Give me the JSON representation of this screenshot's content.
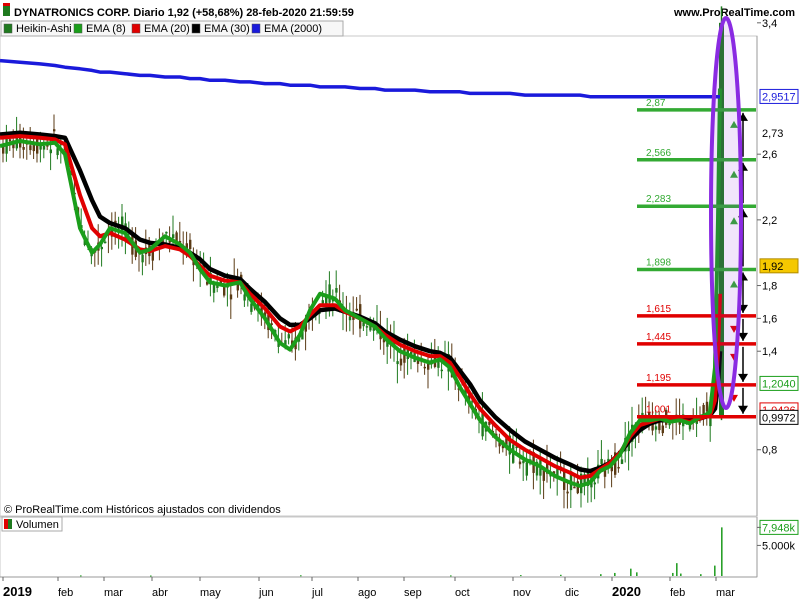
{
  "header": {
    "title": "DYNATRONICS CORP. Diario 1,92 (+58,68%) 28-feb-2020 21:59:59",
    "site": "www.ProRealTime.com"
  },
  "legend": [
    {
      "label": "Heikin-Ashi",
      "color": "#1f7a1f"
    },
    {
      "label": "EMA (8)",
      "color": "#1a9e1a"
    },
    {
      "label": "EMA (20)",
      "color": "#e00000"
    },
    {
      "label": "EMA (30)",
      "color": "#000000"
    },
    {
      "label": "EMA (2000)",
      "color": "#1a1adb"
    }
  ],
  "footer_note": "© ProRealTime.com Históricos ajustados con dividendos",
  "volume_label": "Volumen",
  "chart_data": {
    "type": "line",
    "price_axis": {
      "ylim": [
        0.5,
        3.5
      ],
      "ticks": [
        {
          "v": 3.4,
          "label": "3,4"
        },
        {
          "v": 2.6,
          "label": "2,6"
        },
        {
          "v": 2.2,
          "label": "2,2"
        },
        {
          "v": 1.8,
          "label": "1,8"
        },
        {
          "v": 1.6,
          "label": "1,6"
        },
        {
          "v": 1.4,
          "label": "1,4"
        },
        {
          "v": 0.8,
          "label": "0,8"
        }
      ]
    },
    "time_axis": [
      {
        "label": "2019",
        "bold": true
      },
      {
        "label": "feb"
      },
      {
        "label": "mar"
      },
      {
        "label": "abr"
      },
      {
        "label": "may"
      },
      {
        "label": "jun"
      },
      {
        "label": "jul"
      },
      {
        "label": "ago"
      },
      {
        "label": "sep"
      },
      {
        "label": "oct"
      },
      {
        "label": "nov"
      },
      {
        "label": "dic"
      },
      {
        "label": "2020",
        "bold": true
      },
      {
        "label": "feb"
      },
      {
        "label": "mar"
      }
    ],
    "ema_x": [
      0,
      20,
      40,
      55,
      65,
      80,
      92,
      100,
      110,
      125,
      140,
      150,
      165,
      180,
      190,
      200,
      210,
      225,
      240,
      250,
      265,
      280,
      290,
      300,
      310,
      320,
      335,
      345,
      360,
      375,
      385,
      400,
      415,
      430,
      440,
      450,
      460,
      470,
      480,
      495,
      510,
      525,
      540,
      555,
      570,
      580,
      590,
      600,
      610,
      620,
      630,
      640,
      650,
      660,
      670,
      680,
      690,
      700,
      705,
      710,
      715,
      718,
      720
    ],
    "series": [
      {
        "name": "EMA (8)",
        "color": "#1a9e1a",
        "values": [
          2.65,
          2.68,
          2.66,
          2.67,
          2.6,
          2.15,
          2.0,
          2.05,
          2.15,
          2.12,
          2.0,
          2.02,
          2.1,
          2.05,
          2.0,
          1.9,
          1.82,
          1.8,
          1.82,
          1.72,
          1.6,
          1.45,
          1.41,
          1.5,
          1.65,
          1.75,
          1.72,
          1.65,
          1.6,
          1.55,
          1.48,
          1.4,
          1.36,
          1.33,
          1.35,
          1.3,
          1.18,
          1.08,
          0.98,
          0.88,
          0.8,
          0.74,
          0.7,
          0.64,
          0.6,
          0.58,
          0.6,
          0.67,
          0.7,
          0.77,
          0.9,
          0.98,
          0.98,
          0.99,
          0.97,
          0.98,
          0.96,
          1.0,
          1.01,
          1.03,
          1.3,
          2.2,
          3.0
        ]
      },
      {
        "name": "EMA (20)",
        "color": "#e00000",
        "values": [
          2.7,
          2.71,
          2.7,
          2.69,
          2.66,
          2.35,
          2.15,
          2.1,
          2.12,
          2.08,
          2.02,
          2.01,
          2.04,
          2.02,
          1.98,
          1.92,
          1.86,
          1.83,
          1.82,
          1.75,
          1.66,
          1.55,
          1.52,
          1.55,
          1.62,
          1.68,
          1.68,
          1.64,
          1.6,
          1.55,
          1.5,
          1.44,
          1.4,
          1.37,
          1.37,
          1.33,
          1.24,
          1.14,
          1.05,
          0.95,
          0.86,
          0.8,
          0.75,
          0.7,
          0.66,
          0.63,
          0.64,
          0.68,
          0.72,
          0.78,
          0.88,
          0.95,
          0.97,
          0.99,
          0.98,
          0.98,
          0.97,
          0.99,
          1.0,
          1.01,
          1.1,
          1.4,
          1.75
        ]
      },
      {
        "name": "EMA (30)",
        "color": "#000000",
        "values": [
          2.72,
          2.73,
          2.72,
          2.71,
          2.7,
          2.5,
          2.32,
          2.22,
          2.18,
          2.15,
          2.08,
          2.06,
          2.05,
          2.03,
          2.0,
          1.96,
          1.9,
          1.86,
          1.84,
          1.78,
          1.7,
          1.6,
          1.56,
          1.56,
          1.6,
          1.65,
          1.66,
          1.64,
          1.61,
          1.57,
          1.52,
          1.47,
          1.43,
          1.4,
          1.39,
          1.36,
          1.28,
          1.2,
          1.1,
          1.0,
          0.92,
          0.85,
          0.8,
          0.75,
          0.71,
          0.68,
          0.67,
          0.69,
          0.72,
          0.78,
          0.86,
          0.92,
          0.96,
          0.98,
          0.98,
          0.98,
          0.98,
          0.99,
          1.0,
          1.01,
          1.05,
          1.2,
          1.4
        ]
      },
      {
        "name": "EMA (2000)",
        "color": "#1a1adb",
        "values": [
          3.17,
          3.16,
          3.15,
          3.14,
          3.13,
          3.12,
          3.11,
          3.1,
          3.1,
          3.09,
          3.08,
          3.08,
          3.07,
          3.07,
          3.06,
          3.06,
          3.05,
          3.05,
          3.04,
          3.04,
          3.03,
          3.03,
          3.02,
          3.02,
          3.02,
          3.01,
          3.01,
          3.01,
          3.0,
          3.0,
          2.99,
          2.99,
          2.99,
          2.98,
          2.98,
          2.98,
          2.98,
          2.97,
          2.97,
          2.97,
          2.97,
          2.96,
          2.96,
          2.96,
          2.96,
          2.96,
          2.95,
          2.95,
          2.95,
          2.95,
          2.95,
          2.95,
          2.95,
          2.95,
          2.95,
          2.95,
          2.95,
          2.95,
          2.95,
          2.95,
          2.95,
          2.95,
          2.95
        ]
      }
    ],
    "fib_levels": [
      {
        "label": "2,87",
        "value": 2.87,
        "color": "#33aa33",
        "arrow": "up"
      },
      {
        "label": "2,566",
        "value": 2.566,
        "color": "#33aa33",
        "arrow": "up"
      },
      {
        "label": "2,283",
        "value": 2.283,
        "color": "#33aa33",
        "arrow": "up"
      },
      {
        "label": "1,898",
        "value": 1.898,
        "color": "#33aa33",
        "arrow": "up"
      },
      {
        "label": "1,615",
        "value": 1.615,
        "color": "#e00000",
        "arrow": "down"
      },
      {
        "label": "1,445",
        "value": 1.445,
        "color": "#e00000",
        "arrow": "down"
      },
      {
        "label": "1,195",
        "value": 1.195,
        "color": "#e00000",
        "arrow": "down"
      },
      {
        "label": "1,001",
        "value": 1.001,
        "color": "#e00000",
        "arrow": null
      }
    ],
    "value_tags": [
      {
        "label": "2,9517",
        "value": 2.9517,
        "text_color": "#1a1adb",
        "bg": "#ffffff",
        "border": "#1a1adb"
      },
      {
        "label": "2,73",
        "value": 2.73,
        "text_color": "#000000",
        "bg": "#ffffff",
        "border": null
      },
      {
        "label": "1,92",
        "value": 1.92,
        "text_color": "#000000",
        "bg": "#f5c800",
        "border": "#b08a00"
      },
      {
        "label": "1,2040",
        "value": 1.204,
        "text_color": "#1a9e1a",
        "bg": "#ffffff",
        "border": "#1a9e1a"
      },
      {
        "label": "1,0426",
        "value": 1.0426,
        "text_color": "#e00000",
        "bg": "#ffffff",
        "border": "#e00000"
      },
      {
        "label": "0,9972",
        "value": 0.9972,
        "text_color": "#000000",
        "bg": "#ffffff",
        "border": "#000000"
      }
    ],
    "volume_axis": {
      "max": 8.5,
      "ticks": [
        {
          "v": 7.948,
          "label": "7,948k",
          "tag": true
        },
        {
          "v": 5.0,
          "label": "5.000k",
          "tag": false
        }
      ]
    },
    "volume_bars": [
      {
        "x": 80,
        "v": 0.1
      },
      {
        "x": 150,
        "v": 0.08
      },
      {
        "x": 300,
        "v": 0.12
      },
      {
        "x": 450,
        "v": 0.1
      },
      {
        "x": 520,
        "v": 0.15
      },
      {
        "x": 560,
        "v": 0.2
      },
      {
        "x": 600,
        "v": 0.3
      },
      {
        "x": 614,
        "v": 0.5
      },
      {
        "x": 630,
        "v": 1.2
      },
      {
        "x": 636,
        "v": 0.6
      },
      {
        "x": 672,
        "v": 0.5
      },
      {
        "x": 676,
        "v": 2.1
      },
      {
        "x": 680,
        "v": 0.4
      },
      {
        "x": 700,
        "v": 0.3
      },
      {
        "x": 714,
        "v": 1.7
      },
      {
        "x": 721,
        "v": 7.95
      }
    ],
    "grid": false,
    "legend_position": "top-left"
  },
  "colors": {
    "ha_up": "#1f7a1f",
    "ha_down": "#5a3a14",
    "ellipse": "#8a2be2",
    "arrow": "#000000"
  }
}
